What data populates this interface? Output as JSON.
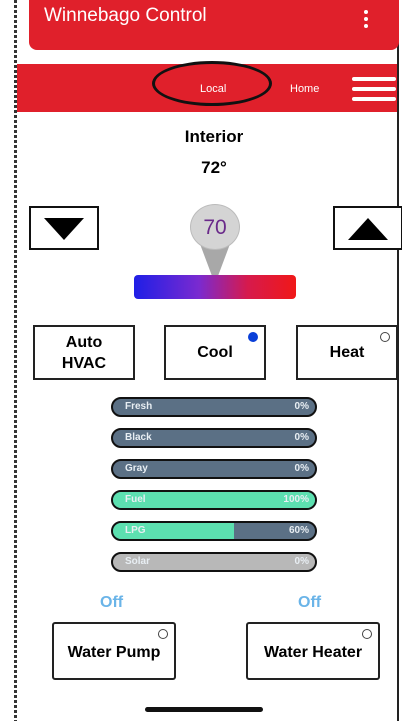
{
  "app_bar": {
    "title": "Winnebago Control"
  },
  "nav": {
    "local_label": "Local",
    "home_label": "Home"
  },
  "interior": {
    "title": "Interior",
    "current_temp": "72°",
    "setpoint": "70"
  },
  "modes": {
    "auto": "Auto HVAC",
    "cool": "Cool",
    "heat": "Heat",
    "selected": "Cool"
  },
  "tanks": [
    {
      "label": "Fresh",
      "value": "0%",
      "level": 0,
      "color": "#5b7085"
    },
    {
      "label": "Black",
      "value": "0%",
      "level": 0,
      "color": "#5b7085"
    },
    {
      "label": "Gray",
      "value": "0%",
      "level": 0,
      "color": "#5b7085"
    },
    {
      "label": "Fuel",
      "value": "100%",
      "level": 1.0,
      "color": "#5ce0b0"
    },
    {
      "label": "LPG",
      "value": "60%",
      "level": 0.6,
      "color": "#5ce0b0"
    },
    {
      "label": "Solar",
      "value": "0%",
      "level": 0,
      "color": "#b8b8b8"
    }
  ],
  "utilities": {
    "water_pump": {
      "label": "Water Pump",
      "status": "Off"
    },
    "water_heater": {
      "label": "Water Heater",
      "status": "Off"
    }
  },
  "colors": {
    "brand_red": "#e0202b",
    "status_off": "#6ab4e8",
    "selected_dot": "#0a3fd8"
  }
}
